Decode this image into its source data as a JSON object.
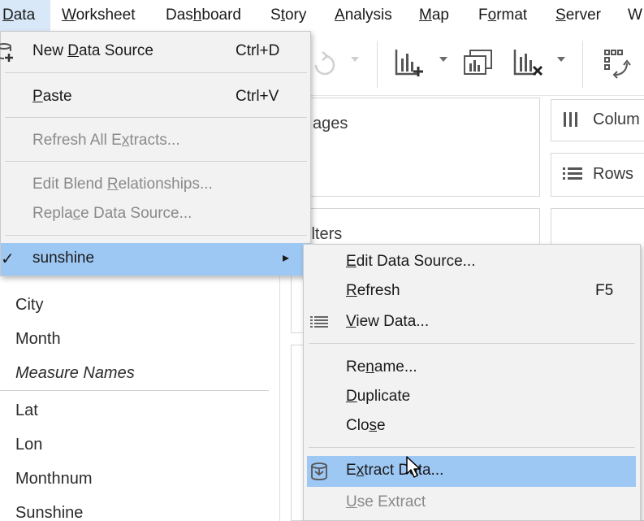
{
  "menubar": {
    "items": [
      {
        "label": "Data",
        "key": "D"
      },
      {
        "label": "Worksheet",
        "key": "W"
      },
      {
        "label": "Dashboard",
        "key": "b"
      },
      {
        "label": "Story",
        "key": "t"
      },
      {
        "label": "Analysis",
        "key": "A"
      },
      {
        "label": "Map",
        "key": "M"
      },
      {
        "label": "Format",
        "key": "o"
      },
      {
        "label": "Server",
        "key": "S"
      },
      {
        "label": "W",
        "key": ""
      }
    ]
  },
  "data_menu": {
    "new_data_source": {
      "pre": "New ",
      "key": "D",
      "post": "ata Source",
      "shortcut": "Ctrl+D"
    },
    "paste": {
      "pre": "",
      "key": "P",
      "post": "aste",
      "shortcut": "Ctrl+V"
    },
    "refresh_all": {
      "pre": "Refresh All E",
      "key": "x",
      "post": "tracts..."
    },
    "edit_blend": {
      "pre": "Edit Blend ",
      "key": "R",
      "post": "elationships..."
    },
    "replace": {
      "pre": "Repla",
      "key": "c",
      "post": "e Data Source..."
    },
    "datasource": {
      "label": "sunshine",
      "check": "✓",
      "arrow": "▸"
    }
  },
  "submenu": {
    "edit_data_source": {
      "pre": "",
      "key": "E",
      "post": "dit Data Source..."
    },
    "refresh": {
      "pre": "",
      "key": "R",
      "post": "efresh",
      "shortcut": "F5"
    },
    "view_data": {
      "pre": "",
      "key": "V",
      "post": "iew Data..."
    },
    "rename": {
      "pre": "Re",
      "key": "n",
      "post": "ame..."
    },
    "duplicate": {
      "pre": "",
      "key": "D",
      "post": "uplicate"
    },
    "close": {
      "pre": "Clo",
      "key": "s",
      "post": "e"
    },
    "extract_data": {
      "pre": "E",
      "key": "x",
      "post": "tract Data..."
    },
    "use_extract": {
      "pre": "",
      "key": "U",
      "post": "se Extract"
    }
  },
  "shelves": {
    "pages": "ages",
    "filters": "ilters",
    "columns": "Colum",
    "rows": "Rows"
  },
  "data_pane": {
    "dimensions": [
      "City",
      "Month",
      "Measure Names"
    ],
    "measures": [
      "Lat",
      "Lon",
      "Monthnum",
      "Sunshine"
    ]
  },
  "colors": {
    "highlight": "#9ec8f4",
    "menu_bg": "#f2f2f2",
    "active_menu": "#d9e8f8"
  }
}
